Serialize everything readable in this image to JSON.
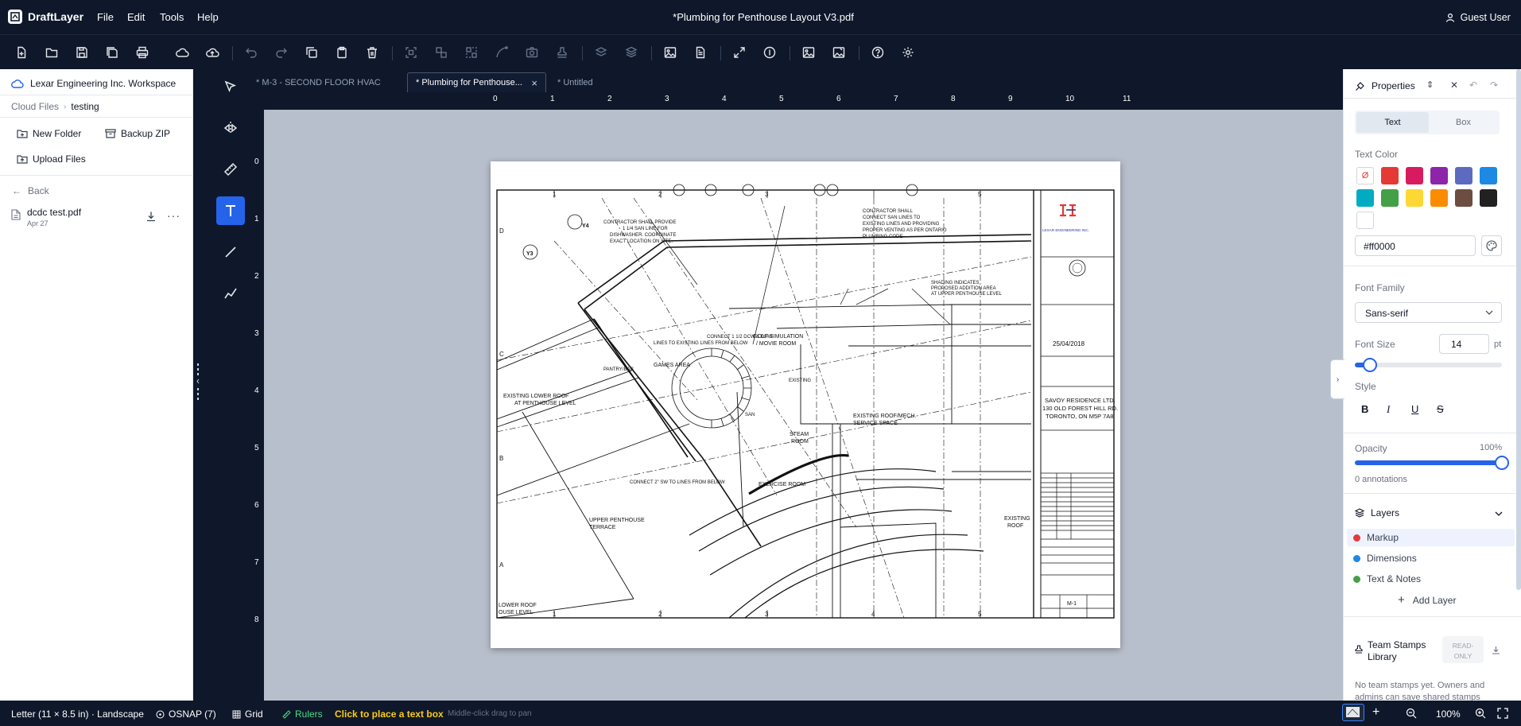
{
  "app": {
    "name": "DraftLayer",
    "title": "*Plumbing for Penthouse Layout V3.pdf",
    "user": "Guest User"
  },
  "menu": [
    "File",
    "Edit",
    "Tools",
    "Help"
  ],
  "toolbar_icons": [
    "new-file-icon",
    "open-folder-icon",
    "save-icon",
    "save-all-icon",
    "print-icon",
    "cloud-icon",
    "cloud-upload-icon",
    "undo-icon",
    "redo-icon",
    "copy-icon",
    "paste-icon",
    "delete-icon",
    "select-target-icon",
    "group-icon",
    "ungroup-icon",
    "curve-icon",
    "camera-icon",
    "stamp-icon",
    "layers-icon",
    "layers-stack-icon",
    "insert-image-icon",
    "document-icon",
    "expand-icon",
    "info-circle-icon",
    "image-icon",
    "image-edit-icon",
    "help-icon",
    "settings-icon"
  ],
  "left": {
    "workspace": "Lexar Engineering Inc. Workspace",
    "breadcrumb": {
      "root": "Cloud Files",
      "current": "testing"
    },
    "buttons": {
      "new_folder": "New Folder",
      "backup_zip": "Backup ZIP",
      "upload_files": "Upload Files"
    },
    "back": "Back",
    "files": [
      {
        "name": "dcdc test.pdf",
        "date": "Apr 27"
      }
    ]
  },
  "tools": [
    "select-tool-icon",
    "mirror-tool-icon",
    "measure-tool-icon",
    "text-tool-icon",
    "line-tool-icon",
    "polyline-tool-icon"
  ],
  "tabs": [
    {
      "label": "M-3 - SECOND FLOOR HVAC",
      "modified": "*"
    },
    {
      "label": "Plumbing for Penthouse...",
      "modified": "*",
      "active": true,
      "close": "×"
    },
    {
      "label": "Untitled",
      "modified": "*"
    }
  ],
  "rulers": {
    "h": [
      "0",
      "1",
      "2",
      "3",
      "4",
      "5",
      "6",
      "7",
      "8",
      "9",
      "10",
      "11"
    ],
    "v": [
      "0",
      "1",
      "2",
      "3",
      "4",
      "5",
      "6",
      "7",
      "8"
    ]
  },
  "drawing": {
    "company": "LEXAR ENGINEERING INC.",
    "date": "25/04/2018",
    "project": [
      "SAVOY RESIDENCE LTD.",
      "130 OLD FOREST HILL RD.",
      "TORONTO, ON M5P 7A8"
    ],
    "sheet": "M-1",
    "labels": {
      "contractor1": [
        "CONTRACTOR SHALL PROVIDE",
        "1 1/4 SAN LINE FOR",
        "DISHWASHER. COORDINATE",
        "EXACT LOCATION ON SITE."
      ],
      "contractor2": [
        "CONTRACTOR SHALL",
        "CONNECT SAN LINES TO",
        "EXISTING LINES AND PROVIDING",
        "PROPER VENTING AS PER ONTARIO",
        "PLUMBING CODE"
      ],
      "shading": [
        "SHADING INDICATES",
        "PROPOSED ADDITION AREA",
        "AT UPPER PENTHOUSE LEVEL"
      ],
      "connect": [
        "CONNECT 1 1/2 DCW & DHW",
        "LINES TO EXISTING LINES FROM BELOW"
      ],
      "golf": [
        "GOLF SIMULATION",
        "/ MOVIE ROOM"
      ],
      "pantry": "PANTRY/BAR",
      "games": "GAMES AREA",
      "lower_roof": [
        "EXISTING LOWER ROOF",
        "AT PENTHOUSE LEVEL"
      ],
      "mech": [
        "EXISTING ROOF/MECH.",
        "SERVICE SPACE"
      ],
      "steam": [
        "STEAM",
        "ROOM"
      ],
      "exercise": "EXERCISE ROOM",
      "connect2": "CONNECT 2\" SW TO LINES FROM BELOW",
      "terrace": [
        "UPPER PENTHOUSE",
        "TERRACE"
      ],
      "existing_roof": [
        "EXISTING",
        "ROOF"
      ],
      "lower_level": [
        "LOWER ROOF",
        "OUSE LEVEL"
      ],
      "san": "SAN",
      "existing": "EXISTING",
      "tags": [
        "Y4",
        "Y3"
      ],
      "grid_top": [
        "1",
        "2",
        "3",
        "5"
      ],
      "grid_bottom": [
        "1",
        "2",
        "3",
        "4",
        "5"
      ],
      "grid_left": [
        "D",
        "C",
        "B",
        "A"
      ]
    }
  },
  "right": {
    "title": "Properties",
    "tabs": {
      "text": "Text",
      "box": "Box"
    },
    "text_color_label": "Text Color",
    "colors": [
      "#e53935",
      "#d81b60",
      "#8e24aa",
      "#5c6bc0",
      "#1e88e5",
      "#00acc1",
      "#43a047",
      "#fdd835",
      "#fb8c00",
      "#6d4c41",
      "#212121",
      "#ffffff"
    ],
    "no_color_glyph": "Ø",
    "hex_value": "#ff0000",
    "font_family_label": "Font Family",
    "font_family": "Sans-serif",
    "font_size_label": "Font Size",
    "font_size": "14",
    "font_size_unit": "pt",
    "font_size_slider": 0.1,
    "style_label": "Style",
    "style_buttons": [
      "B",
      "I",
      "U",
      "S"
    ],
    "opacity_label": "Opacity",
    "opacity_value": "100%",
    "opacity": 1.0,
    "annotations": "0 annotations",
    "layers_title": "Layers",
    "layers": [
      {
        "name": "Markup",
        "color": "#e53935"
      },
      {
        "name": "Dimensions",
        "color": "#1e88e5"
      },
      {
        "name": "Text & Notes",
        "color": "#43a047"
      }
    ],
    "add_layer": "Add Layer",
    "stamps_title": [
      "Team Stamps",
      "Library"
    ],
    "read_only": [
      "READ-",
      "ONLY"
    ],
    "stamps_note": "No team stamps yet. Owners and admins can save shared stamps"
  },
  "status": {
    "page": "Letter (11 × 8.5 in) · Landscape",
    "osnap": "OSNAP (7)",
    "grid": "Grid",
    "rulers": "Rulers",
    "hint": "Click to place a text box",
    "subhint": "Middle-click drag to pan",
    "zoom": "100%",
    "accent": "#facc15"
  }
}
